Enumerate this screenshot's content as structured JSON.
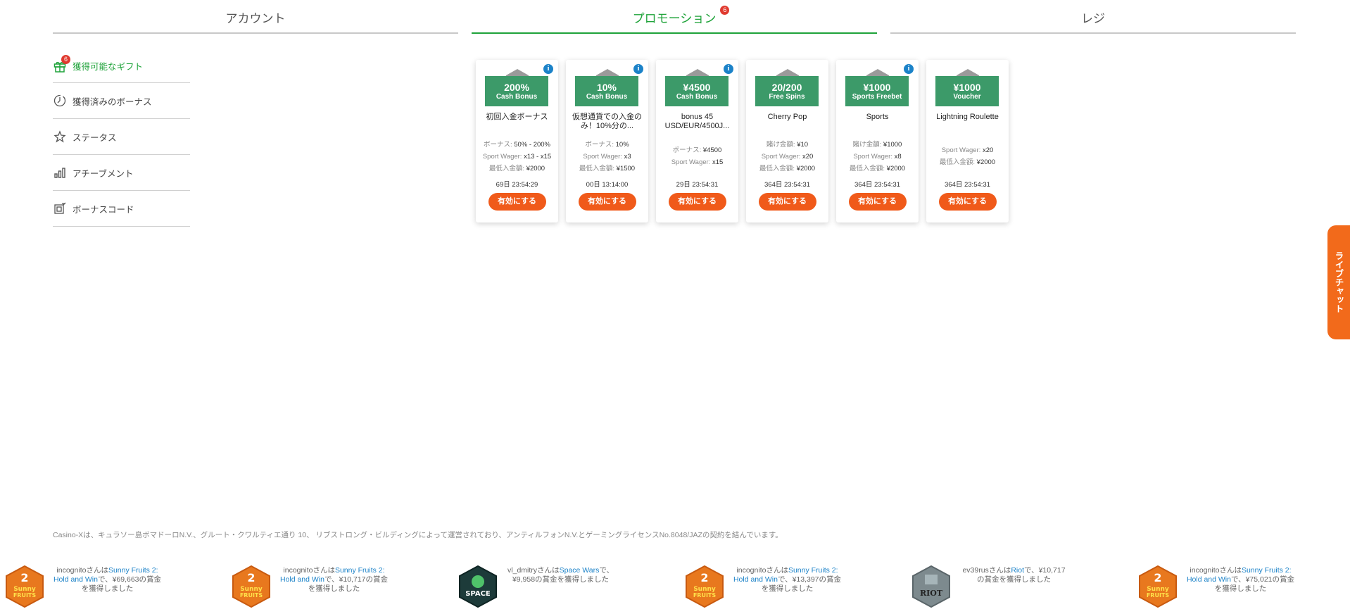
{
  "tabs": [
    {
      "label": "アカウント",
      "badge": ""
    },
    {
      "label": "プロモーション",
      "badge": "6"
    },
    {
      "label": "レジ",
      "badge": ""
    }
  ],
  "sidebar": {
    "items": [
      {
        "label": "獲得可能なギフト",
        "icon": "gift-icon",
        "badge": "6"
      },
      {
        "label": "獲得済みのボーナス",
        "icon": "clock-icon",
        "badge": ""
      },
      {
        "label": "ステータス",
        "icon": "star-icon",
        "badge": ""
      },
      {
        "label": "アチーブメント",
        "icon": "chart-icon",
        "badge": ""
      },
      {
        "label": "ボーナスコード",
        "icon": "code-icon",
        "badge": ""
      }
    ]
  },
  "cards": [
    {
      "amount": "200%",
      "type": "Cash Bonus",
      "title": "初回入金ボーナス",
      "info": true,
      "lines": [
        {
          "label": "ボーナス:",
          "value": "50% - 200%"
        },
        {
          "label": "Sport Wager:",
          "value": "x13 - x15"
        },
        {
          "label": "最低入金額:",
          "value": "¥2000"
        }
      ],
      "timer": "69日  23:54:29",
      "button": "有効にする"
    },
    {
      "amount": "10%",
      "type": "Cash Bonus",
      "title": "仮想通貨での入金のみ！10%分の...",
      "info": true,
      "lines": [
        {
          "label": "ボーナス:",
          "value": "10%"
        },
        {
          "label": "Sport Wager:",
          "value": "x3"
        },
        {
          "label": "最低入金額:",
          "value": "¥1500"
        }
      ],
      "timer": "00日  13:14:00",
      "button": "有効にする"
    },
    {
      "amount": "¥4500",
      "type": "Cash Bonus",
      "title": "bonus 45 USD/EUR/4500J...",
      "info": true,
      "lines": [
        {
          "label": "ボーナス:",
          "value": "¥4500"
        },
        {
          "label": "Sport Wager:",
          "value": "x15"
        }
      ],
      "timer": "29日  23:54:31",
      "button": "有効にする"
    },
    {
      "amount": "20/200",
      "type": "Free Spins",
      "title": "Cherry Pop",
      "info": false,
      "lines": [
        {
          "label": "賭け金額:",
          "value": "¥10"
        },
        {
          "label": "Sport Wager:",
          "value": "x20"
        },
        {
          "label": "最低入金額:",
          "value": "¥2000"
        }
      ],
      "timer": "364日  23:54:31",
      "button": "有効にする"
    },
    {
      "amount": "¥1000",
      "type": "Sports Freebet",
      "title": "Sports",
      "info": true,
      "lines": [
        {
          "label": "賭け金額:",
          "value": "¥1000"
        },
        {
          "label": "Sport Wager:",
          "value": "x8"
        },
        {
          "label": "最低入金額:",
          "value": "¥2000"
        }
      ],
      "timer": "364日  23:54:31",
      "button": "有効にする"
    },
    {
      "amount": "¥1000",
      "type": "Voucher",
      "title": "Lightning Roulette",
      "info": false,
      "lines": [
        {
          "label": "Sport Wager:",
          "value": "x20"
        },
        {
          "label": "最低入金額:",
          "value": "¥2000"
        }
      ],
      "timer": "364日  23:54:31",
      "button": "有効にする"
    }
  ],
  "livechat": {
    "label": "ライブチャット"
  },
  "legal": "Casino-Xは、キュラソー島ボマドーロN.V.、グルート・クワルティエ通り 10、 リブストロング・ビルディングによって運営されており、アンティルフォンN.V.とゲーミングライセンスNo.8048/JAZの契約を結んでいます。",
  "ticker": [
    {
      "user": "incognito",
      "pre": "さんは",
      "game": "Sunny Fruits 2: Hold and Win",
      "post": "で、¥69,663の賞金を獲得しました",
      "icon": "sunny-fruits-icon"
    },
    {
      "user": "incognito",
      "pre": "さんは",
      "game": "Sunny Fruits 2: Hold and Win",
      "post": "で、¥10,717の賞金を獲得しました",
      "icon": "sunny-fruits-icon"
    },
    {
      "user": "vl_dmitry",
      "pre": "さんは",
      "game": "Space Wars",
      "post": "で、¥9,958の賞金を獲得しました",
      "icon": "space-wars-icon"
    },
    {
      "user": "incognito",
      "pre": "さんは",
      "game": "Sunny Fruits 2: Hold and Win",
      "post": "で、¥13,397の賞金を獲得しました",
      "icon": "sunny-fruits-icon"
    },
    {
      "user": "ev39rus",
      "pre": "さんは",
      "game": "Riot",
      "post": "で、¥10,717の賞金を獲得しました",
      "icon": "riot-icon"
    },
    {
      "user": "incognito",
      "pre": "さんは",
      "game": "Sunny Fruits 2: Hold and Win",
      "post": "で、¥75,021の賞金を獲得しました",
      "icon": "sunny-fruits-icon"
    }
  ],
  "colors": {
    "accent": "#1fa33a",
    "button": "#f05a1a",
    "ribbon": "#3c9a69",
    "info": "#1b82c8",
    "badge": "#e03a2f"
  }
}
